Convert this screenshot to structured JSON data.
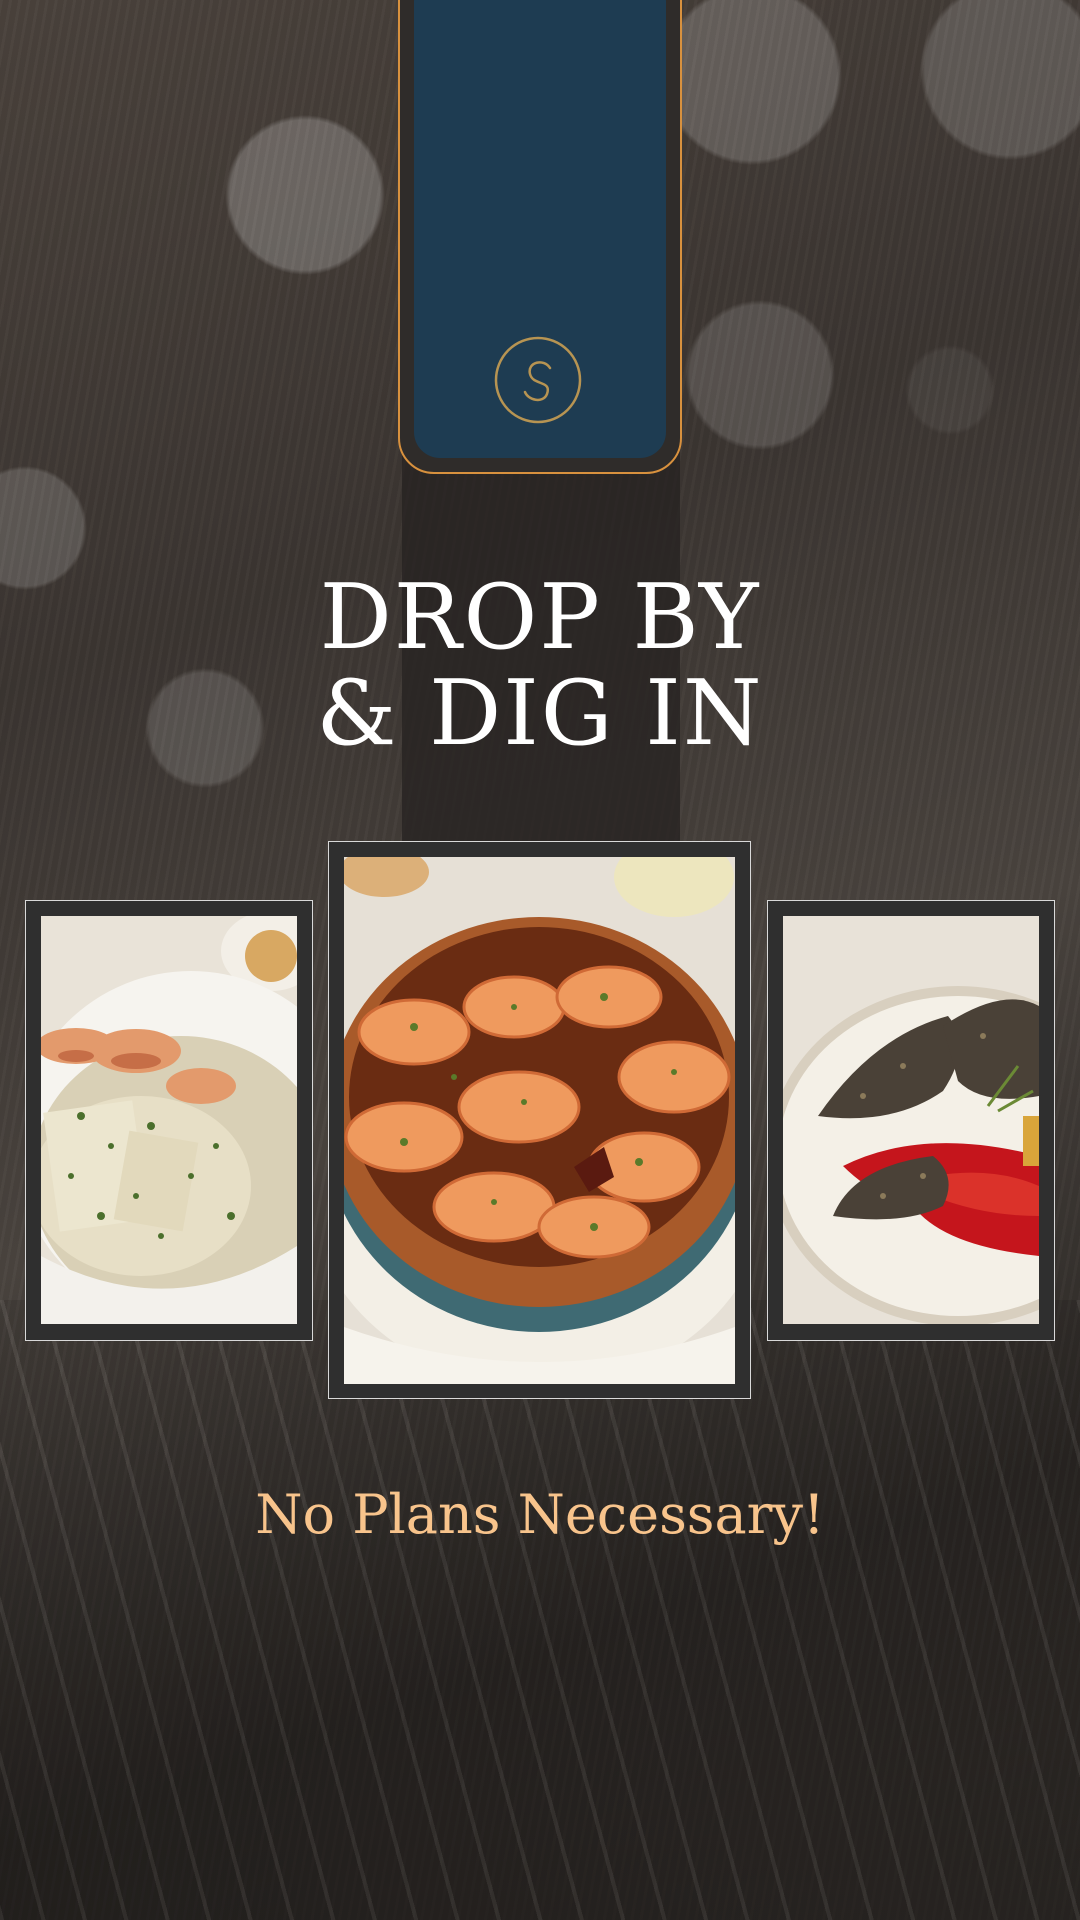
{
  "headline": {
    "line1": "DROP BY",
    "line2": "& DIG IN"
  },
  "tagline": "No Plans Necessary!",
  "colors": {
    "accent_orange": "#d8913e",
    "phone_screen": "#1e3c52",
    "tagline": "#f8c48c",
    "headline": "#ffffff"
  },
  "icons": {
    "logo": "circled-s-logo"
  }
}
